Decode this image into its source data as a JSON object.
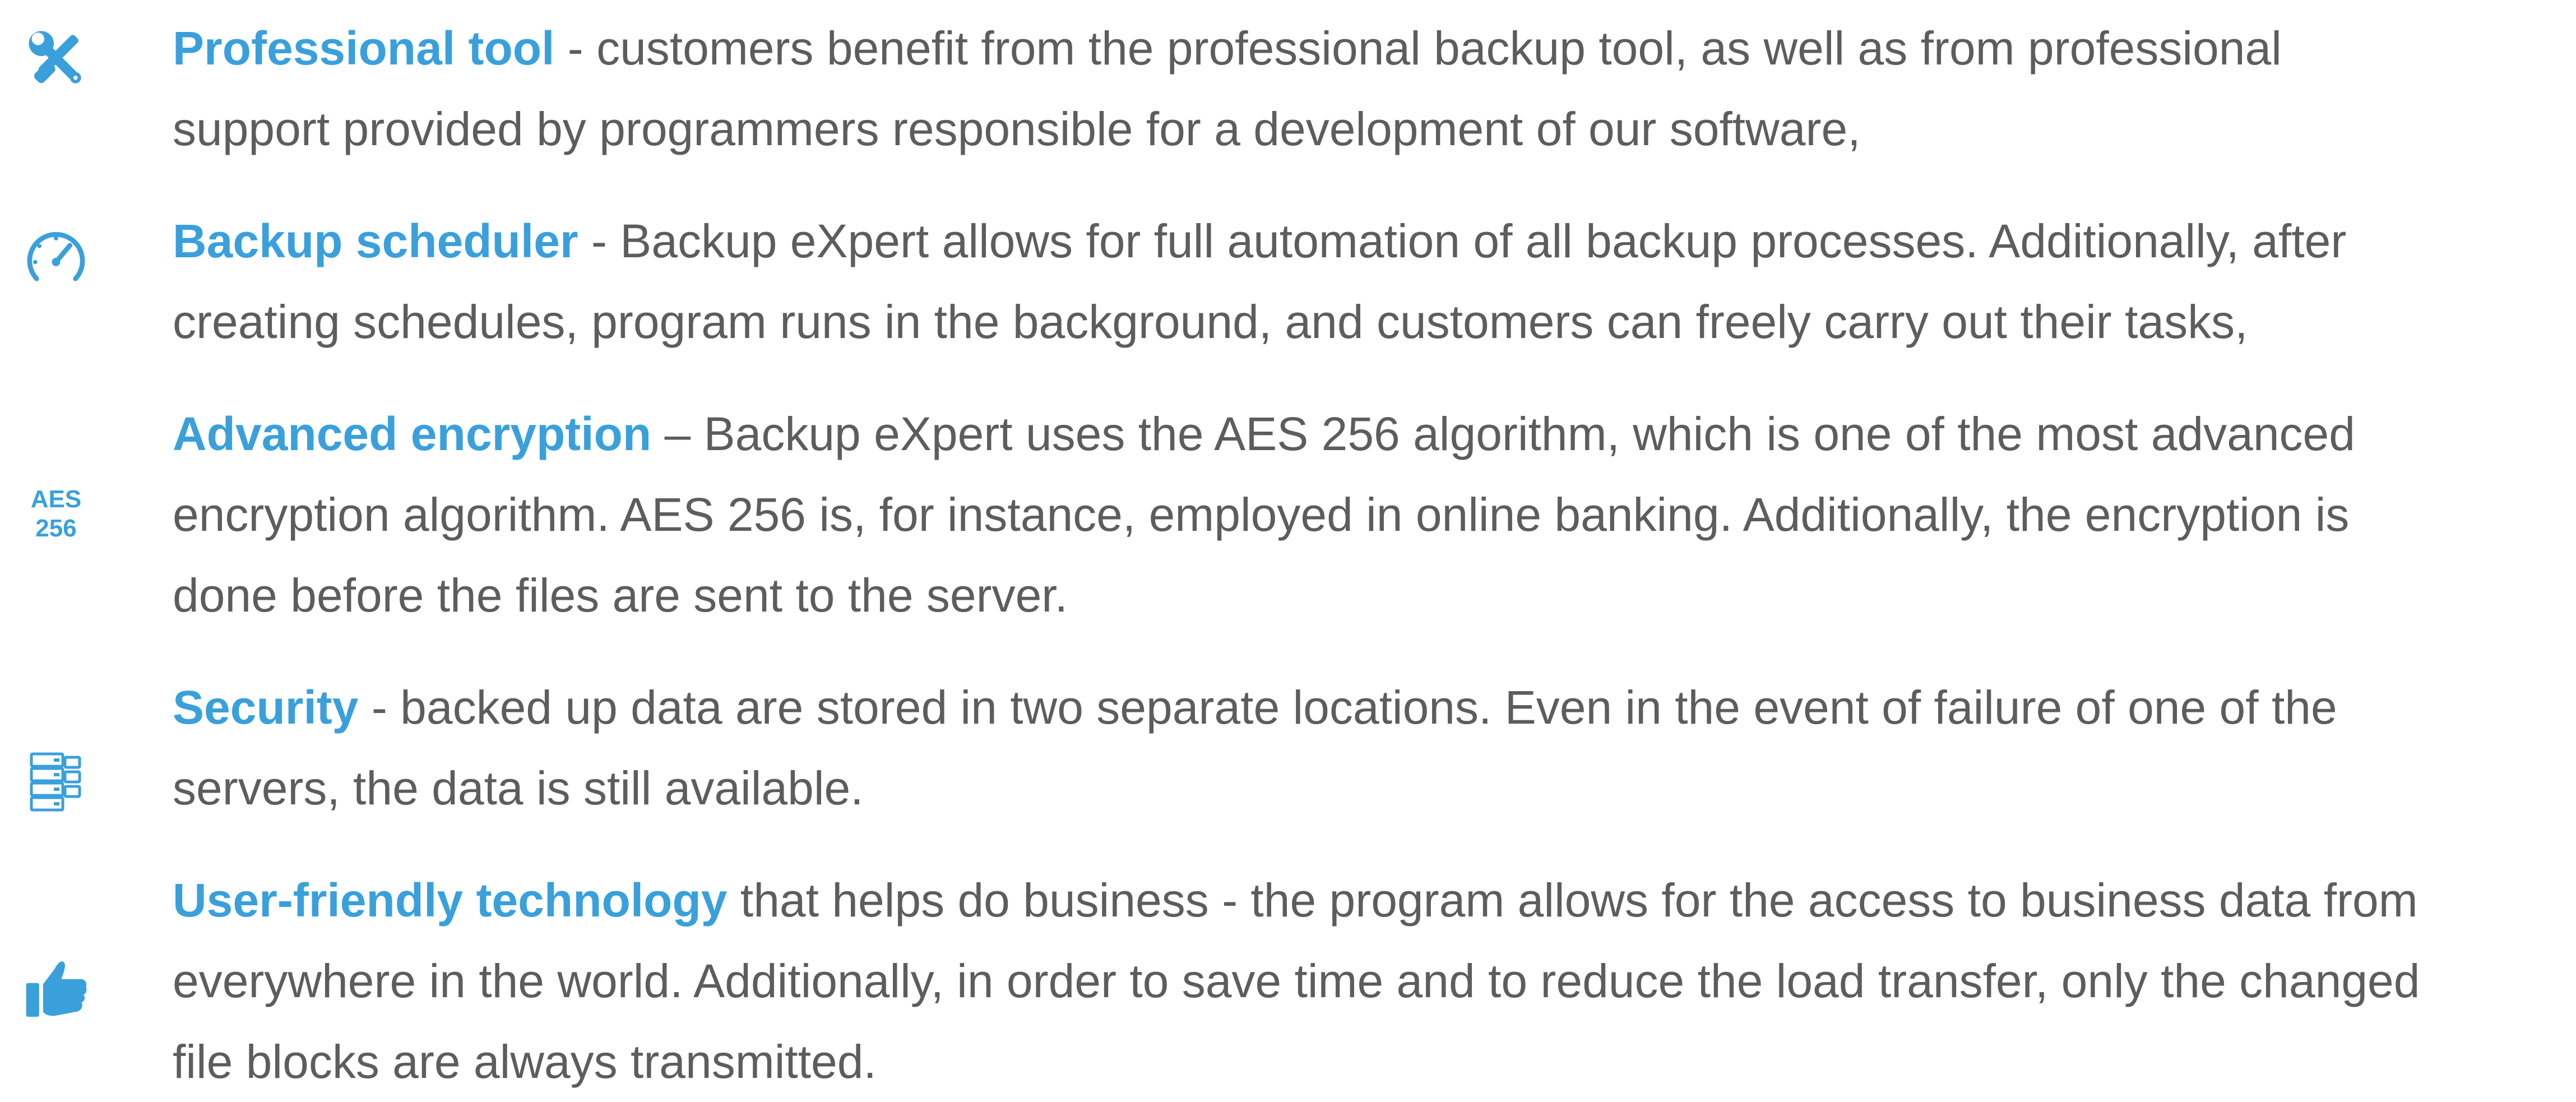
{
  "colors": {
    "accent": "#3aa0dc",
    "body_text": "#5d5d5d",
    "background": "#ffffff"
  },
  "features": [
    {
      "icon": "wrench-screwdriver-icon",
      "title": "Professional tool",
      "lines": [
        " - customers benefit from the professional backup tool, as well as from professional",
        "support provided by programmers responsible for a development of our software,"
      ]
    },
    {
      "icon": "speedometer-icon",
      "title": "Backup scheduler",
      "lines": [
        " - Backup eXpert allows for full automation of all backup processes. Additionally, after",
        "creating schedules, program runs in the background, and customers can freely carry out their tasks,"
      ]
    },
    {
      "icon": "aes-256-icon",
      "icon_text": [
        "AES",
        "256"
      ],
      "title": "Advanced encryption",
      "lines": [
        " – Backup eXpert uses the AES 256 algorithm, which is one of the most advanced",
        "encryption algorithm. AES 256 is, for instance, employed in online banking. Additionally, the encryption is",
        "done before the files are sent to the server."
      ]
    },
    {
      "icon": "server-rack-icon",
      "title": "Security",
      "lines": [
        " - backed up data are stored in two separate locations. Even in the event of failure of one of the",
        "servers, the data is still available."
      ]
    },
    {
      "icon": "thumbs-up-icon",
      "title": "User-friendly technology",
      "lines": [
        " that helps do business - the program allows for the access to business data from",
        "everywhere in the world. Additionally, in order to save time and to reduce the load transfer, only the changed",
        "file blocks are always transmitted."
      ]
    }
  ]
}
